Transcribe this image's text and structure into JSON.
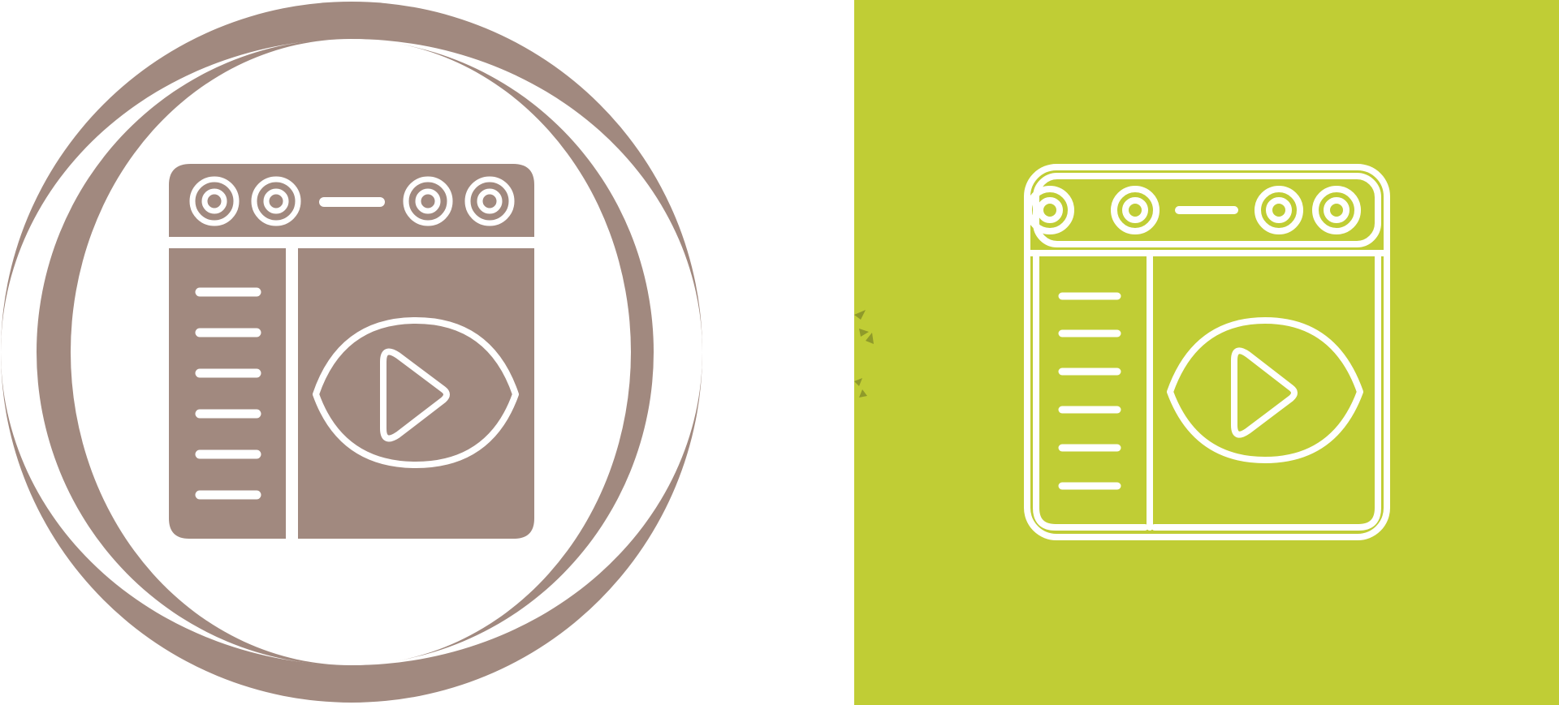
{
  "colors": {
    "background": "#ffffff",
    "glyph_brown": "#a1897f",
    "panel_green": "#c0cd35",
    "stroke_white": "#ffffff"
  },
  "icons": [
    {
      "name": "video-watch-icon-glyph",
      "style": "glyph",
      "container": "circle-badge"
    },
    {
      "name": "video-watch-icon-line",
      "style": "outline",
      "container": "square-panel"
    }
  ]
}
